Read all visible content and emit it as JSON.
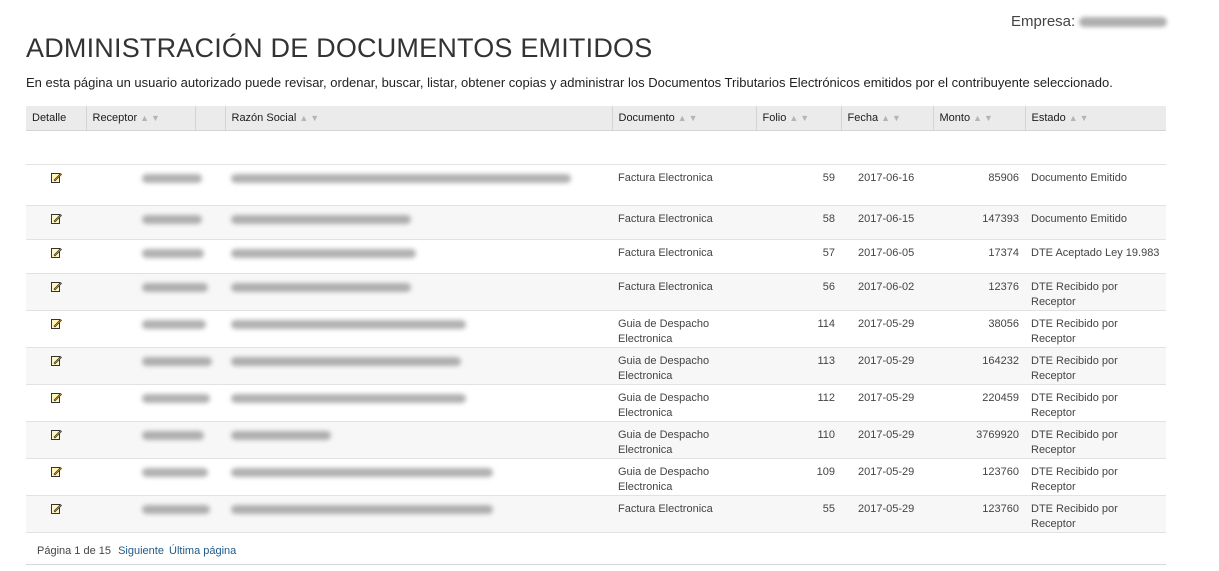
{
  "header": {
    "company_label": "Empresa:",
    "page_title": "ADMINISTRACIÓN DE DOCUMENTOS EMITIDOS",
    "intro": "En esta página un usuario autorizado puede revisar, ordenar, buscar, listar, obtener copias y administrar los Documentos Tributarios Electrónicos emitidos por el contribuyente seleccionado."
  },
  "table": {
    "columns": {
      "detalle": "Detalle",
      "receptor": "Receptor",
      "razon_social": "Razón Social",
      "documento": "Documento",
      "folio": "Folio",
      "fecha": "Fecha",
      "monto": "Monto",
      "estado": "Estado"
    },
    "sort_glyph": "▲▼",
    "edit_icon": "edit-icon",
    "rows": [
      {
        "documento": "Factura Electronica",
        "folio": "59",
        "fecha": "2017-06-16",
        "monto": "85906",
        "estado": "Documento Emitido"
      },
      {
        "documento": "Factura Electronica",
        "folio": "58",
        "fecha": "2017-06-15",
        "monto": "147393",
        "estado": "Documento Emitido"
      },
      {
        "documento": "Factura Electronica",
        "folio": "57",
        "fecha": "2017-06-05",
        "monto": "17374",
        "estado": "DTE Aceptado Ley 19.983"
      },
      {
        "documento": "Factura Electronica",
        "folio": "56",
        "fecha": "2017-06-02",
        "monto": "12376",
        "estado": "DTE Recibido por Receptor"
      },
      {
        "documento": "Guia de Despacho Electronica",
        "folio": "114",
        "fecha": "2017-05-29",
        "monto": "38056",
        "estado": "DTE Recibido por Receptor"
      },
      {
        "documento": "Guia de Despacho Electronica",
        "folio": "113",
        "fecha": "2017-05-29",
        "monto": "164232",
        "estado": "DTE Recibido por Receptor"
      },
      {
        "documento": "Guia de Despacho Electronica",
        "folio": "112",
        "fecha": "2017-05-29",
        "monto": "220459",
        "estado": "DTE Recibido por Receptor"
      },
      {
        "documento": "Guia de Despacho Electronica",
        "folio": "110",
        "fecha": "2017-05-29",
        "monto": "3769920",
        "estado": "DTE Recibido por Receptor"
      },
      {
        "documento": "Guia de Despacho Electronica",
        "folio": "109",
        "fecha": "2017-05-29",
        "monto": "123760",
        "estado": "DTE Recibido por Receptor"
      },
      {
        "documento": "Factura Electronica",
        "folio": "55",
        "fecha": "2017-05-29",
        "monto": "123760",
        "estado": "DTE Recibido por Receptor"
      }
    ]
  },
  "pager": {
    "status": "Página 1 de 15",
    "next_label": "Siguiente",
    "last_label": "Última página"
  }
}
